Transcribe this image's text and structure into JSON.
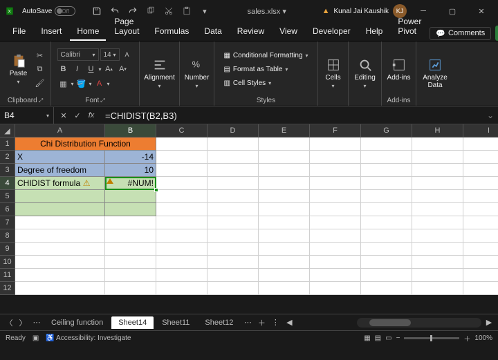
{
  "titlebar": {
    "autosave_label": "AutoSave",
    "autosave_state": "Off",
    "filename": "sales.xlsx ▾",
    "user": "Kunal Jai Kaushik",
    "user_initials": "KJ"
  },
  "ribbon_tabs": [
    "File",
    "Insert",
    "Home",
    "Page Layout",
    "Formulas",
    "Data",
    "Review",
    "View",
    "Developer",
    "Help",
    "Power Pivot"
  ],
  "ribbon_active": "Home",
  "comments_label": "Comments",
  "font": {
    "name": "Calibri",
    "size": "14"
  },
  "ribbon_groups": {
    "clipboard": "Clipboard",
    "font": "Font",
    "alignment": "Alignment",
    "number": "Number",
    "styles": "Styles",
    "cells": "Cells",
    "editing": "Editing",
    "addins": "Add-ins"
  },
  "ribbon_buttons": {
    "paste": "Paste",
    "alignment": "Alignment",
    "number": "Number",
    "cond_fmt": "Conditional Formatting",
    "fmt_table": "Format as Table",
    "cell_styles": "Cell Styles",
    "cells": "Cells",
    "editing": "Editing",
    "addins": "Add-ins",
    "analyze": "Analyze Data"
  },
  "namebox": "B4",
  "formula": "=CHIDIST(B2,B3)",
  "columns": [
    "A",
    "B",
    "C",
    "D",
    "E",
    "F",
    "G",
    "H",
    "I"
  ],
  "rows": [
    "1",
    "2",
    "3",
    "4",
    "5",
    "6",
    "7",
    "8",
    "9",
    "10",
    "11",
    "12"
  ],
  "cells": {
    "a1": "Chi Distribution Function",
    "a2": "X",
    "b2": "-14",
    "a3": "Degree of freedom",
    "b3": "10",
    "a4": "CHIDIST formula",
    "b4": "#NUM!"
  },
  "sheet_tabs": {
    "prev": "Ceiling function",
    "active": "Sheet14",
    "s3": "Sheet11",
    "s4": "Sheet12"
  },
  "status": {
    "ready": "Ready",
    "access": "Accessibility: Investigate",
    "zoom": "100%"
  }
}
